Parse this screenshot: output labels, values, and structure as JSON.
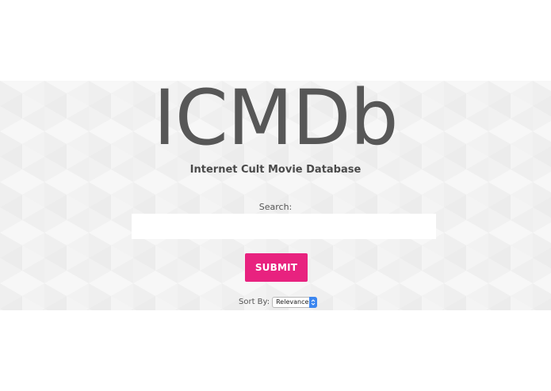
{
  "brand": {
    "logo_text": "ICMDb",
    "tagline": "Internet Cult Movie Database"
  },
  "search": {
    "label": "Search:",
    "value": "",
    "placeholder": ""
  },
  "submit": {
    "label": "SUBMIT"
  },
  "sort": {
    "label": "Sort By:",
    "selected": "Relevance"
  },
  "colors": {
    "accent": "#e8227f",
    "logo": "#575757",
    "select_arrow": "#3b86f0"
  },
  "icons": {
    "sort_arrows": "updown-chevron-icon"
  }
}
